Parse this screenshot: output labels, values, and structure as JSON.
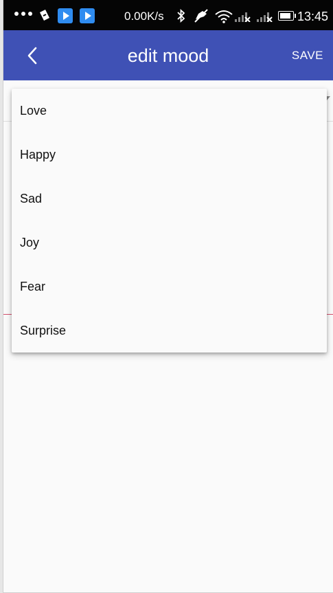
{
  "status_bar": {
    "speed": "0.00K/s",
    "time": "13:45",
    "icons": [
      "more-dots-icon",
      "nfc-icon",
      "play-icon",
      "play-icon",
      "bluetooth-icon",
      "mute-icon",
      "wifi-icon",
      "signal-icon",
      "signal-icon",
      "battery-icon"
    ]
  },
  "app_bar": {
    "back_icon": "chevron-left-icon",
    "title": "edit mood",
    "save_label": "SAVE",
    "color": "#3f51b5"
  },
  "dropdown": {
    "options": [
      "Love",
      "Happy",
      "Sad",
      "Joy",
      "Fear",
      "Surprise"
    ]
  }
}
